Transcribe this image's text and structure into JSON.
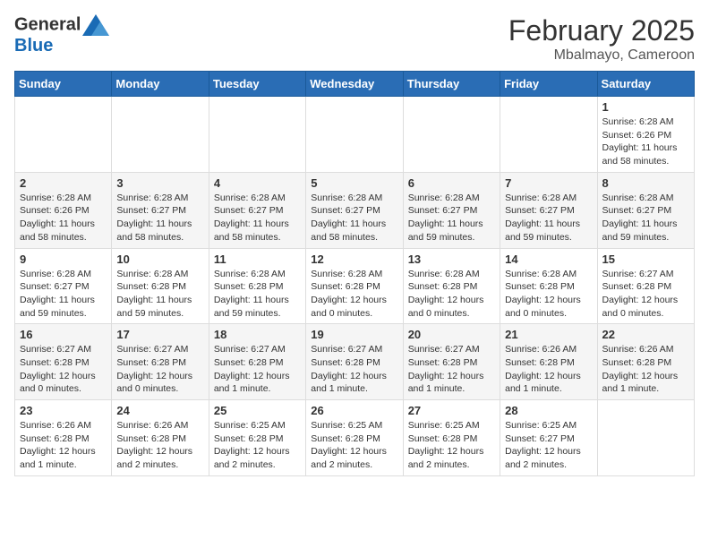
{
  "header": {
    "logo_text_general": "General",
    "logo_text_blue": "Blue",
    "month": "February 2025",
    "location": "Mbalmayo, Cameroon"
  },
  "days_of_week": [
    "Sunday",
    "Monday",
    "Tuesday",
    "Wednesday",
    "Thursday",
    "Friday",
    "Saturday"
  ],
  "weeks": [
    [
      {
        "day": "",
        "info": ""
      },
      {
        "day": "",
        "info": ""
      },
      {
        "day": "",
        "info": ""
      },
      {
        "day": "",
        "info": ""
      },
      {
        "day": "",
        "info": ""
      },
      {
        "day": "",
        "info": ""
      },
      {
        "day": "1",
        "info": "Sunrise: 6:28 AM\nSunset: 6:26 PM\nDaylight: 11 hours and 58 minutes."
      }
    ],
    [
      {
        "day": "2",
        "info": "Sunrise: 6:28 AM\nSunset: 6:26 PM\nDaylight: 11 hours and 58 minutes."
      },
      {
        "day": "3",
        "info": "Sunrise: 6:28 AM\nSunset: 6:27 PM\nDaylight: 11 hours and 58 minutes."
      },
      {
        "day": "4",
        "info": "Sunrise: 6:28 AM\nSunset: 6:27 PM\nDaylight: 11 hours and 58 minutes."
      },
      {
        "day": "5",
        "info": "Sunrise: 6:28 AM\nSunset: 6:27 PM\nDaylight: 11 hours and 58 minutes."
      },
      {
        "day": "6",
        "info": "Sunrise: 6:28 AM\nSunset: 6:27 PM\nDaylight: 11 hours and 59 minutes."
      },
      {
        "day": "7",
        "info": "Sunrise: 6:28 AM\nSunset: 6:27 PM\nDaylight: 11 hours and 59 minutes."
      },
      {
        "day": "8",
        "info": "Sunrise: 6:28 AM\nSunset: 6:27 PM\nDaylight: 11 hours and 59 minutes."
      }
    ],
    [
      {
        "day": "9",
        "info": "Sunrise: 6:28 AM\nSunset: 6:27 PM\nDaylight: 11 hours and 59 minutes."
      },
      {
        "day": "10",
        "info": "Sunrise: 6:28 AM\nSunset: 6:28 PM\nDaylight: 11 hours and 59 minutes."
      },
      {
        "day": "11",
        "info": "Sunrise: 6:28 AM\nSunset: 6:28 PM\nDaylight: 11 hours and 59 minutes."
      },
      {
        "day": "12",
        "info": "Sunrise: 6:28 AM\nSunset: 6:28 PM\nDaylight: 12 hours and 0 minutes."
      },
      {
        "day": "13",
        "info": "Sunrise: 6:28 AM\nSunset: 6:28 PM\nDaylight: 12 hours and 0 minutes."
      },
      {
        "day": "14",
        "info": "Sunrise: 6:28 AM\nSunset: 6:28 PM\nDaylight: 12 hours and 0 minutes."
      },
      {
        "day": "15",
        "info": "Sunrise: 6:27 AM\nSunset: 6:28 PM\nDaylight: 12 hours and 0 minutes."
      }
    ],
    [
      {
        "day": "16",
        "info": "Sunrise: 6:27 AM\nSunset: 6:28 PM\nDaylight: 12 hours and 0 minutes."
      },
      {
        "day": "17",
        "info": "Sunrise: 6:27 AM\nSunset: 6:28 PM\nDaylight: 12 hours and 0 minutes."
      },
      {
        "day": "18",
        "info": "Sunrise: 6:27 AM\nSunset: 6:28 PM\nDaylight: 12 hours and 1 minute."
      },
      {
        "day": "19",
        "info": "Sunrise: 6:27 AM\nSunset: 6:28 PM\nDaylight: 12 hours and 1 minute."
      },
      {
        "day": "20",
        "info": "Sunrise: 6:27 AM\nSunset: 6:28 PM\nDaylight: 12 hours and 1 minute."
      },
      {
        "day": "21",
        "info": "Sunrise: 6:26 AM\nSunset: 6:28 PM\nDaylight: 12 hours and 1 minute."
      },
      {
        "day": "22",
        "info": "Sunrise: 6:26 AM\nSunset: 6:28 PM\nDaylight: 12 hours and 1 minute."
      }
    ],
    [
      {
        "day": "23",
        "info": "Sunrise: 6:26 AM\nSunset: 6:28 PM\nDaylight: 12 hours and 1 minute."
      },
      {
        "day": "24",
        "info": "Sunrise: 6:26 AM\nSunset: 6:28 PM\nDaylight: 12 hours and 2 minutes."
      },
      {
        "day": "25",
        "info": "Sunrise: 6:25 AM\nSunset: 6:28 PM\nDaylight: 12 hours and 2 minutes."
      },
      {
        "day": "26",
        "info": "Sunrise: 6:25 AM\nSunset: 6:28 PM\nDaylight: 12 hours and 2 minutes."
      },
      {
        "day": "27",
        "info": "Sunrise: 6:25 AM\nSunset: 6:28 PM\nDaylight: 12 hours and 2 minutes."
      },
      {
        "day": "28",
        "info": "Sunrise: 6:25 AM\nSunset: 6:27 PM\nDaylight: 12 hours and 2 minutes."
      },
      {
        "day": "",
        "info": ""
      }
    ]
  ]
}
